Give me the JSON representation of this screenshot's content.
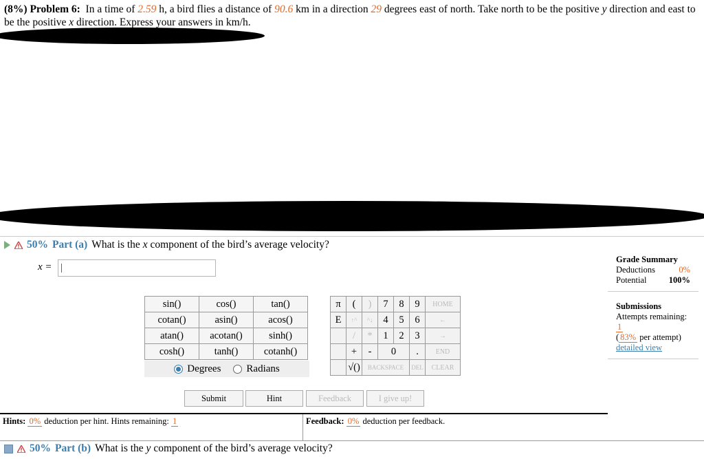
{
  "problem": {
    "prefix": "(8%) Problem 6:",
    "t1": "In a time of",
    "time": "2.59",
    "t2": "h, a bird flies a distance of",
    "distance": "90.6",
    "t3": "km in a direction",
    "angle": "29",
    "t4": "degrees east of north. Take north to be the positive",
    "yvar": "y",
    "t5": "direction and east to be the positive",
    "xvar": "x",
    "t6": "direction. Express your answers in km/h."
  },
  "part_a": {
    "percent": "50%",
    "label": "Part (a)",
    "question_pre": "What is the",
    "var": "x",
    "question_post": "component of the bird’s average velocity?",
    "input_label": "x =",
    "input_value": ""
  },
  "part_b": {
    "percent": "50%",
    "label": "Part (b)",
    "question_pre": "What is the",
    "var": "y",
    "question_post": "component of the bird’s average velocity?"
  },
  "calculator": {
    "functions": [
      [
        "sin()",
        "cos()",
        "tan()"
      ],
      [
        "cotan()",
        "asin()",
        "acos()"
      ],
      [
        "atan()",
        "acotan()",
        "sinh()"
      ],
      [
        "cosh()",
        "tanh()",
        "cotanh()"
      ]
    ],
    "degrees": "Degrees",
    "radians": "Radians",
    "keys": {
      "pi": "π",
      "lparen": "(",
      "rparen": ")",
      "e": "E",
      "up": "↑^",
      "down": "^↓",
      "slash": "/",
      "star": "*",
      "plus": "+",
      "minus": "-",
      "sqrt": "√()",
      "n7": "7",
      "n8": "8",
      "n9": "9",
      "n4": "4",
      "n5": "5",
      "n6": "6",
      "n1": "1",
      "n2": "2",
      "n3": "3",
      "n0": "0",
      "dot": ".",
      "home": "HOME",
      "left": "←",
      "right": "→",
      "end": "END",
      "backspace": "BACKSPACE",
      "del": "DEL",
      "clear": "CLEAR"
    }
  },
  "buttons": {
    "submit": "Submit",
    "hint": "Hint",
    "feedback": "Feedback",
    "give_up": "I give up!"
  },
  "hints": {
    "label": "Hints:",
    "deduction": "0%",
    "text": "deduction per hint. Hints remaining:",
    "remaining": "1"
  },
  "feedback": {
    "label": "Feedback:",
    "deduction": "0%",
    "text": "deduction per feedback."
  },
  "grade_summary": {
    "title": "Grade Summary",
    "deductions_label": "Deductions",
    "deductions_value": "0%",
    "potential_label": "Potential",
    "potential_value": "100%"
  },
  "submissions": {
    "title": "Submissions",
    "attempts_label": "Attempts remaining:",
    "attempts_value": "1",
    "per_attempt_pct": "83%",
    "per_attempt_text": "per attempt)",
    "detailed_view": "detailed view"
  }
}
